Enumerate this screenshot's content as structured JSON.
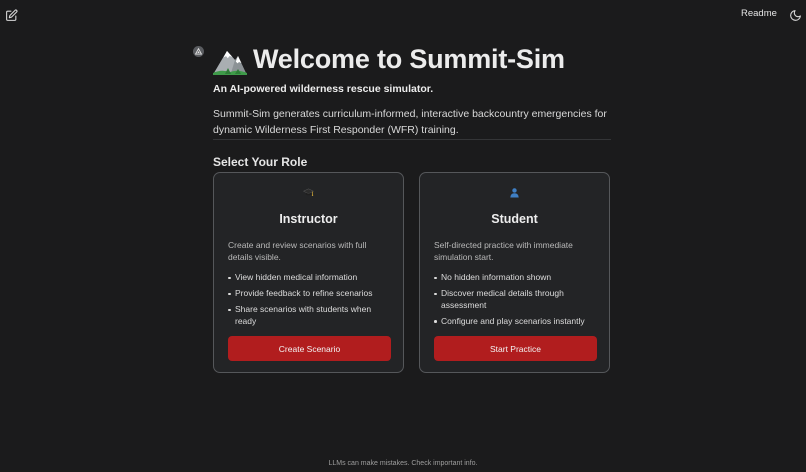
{
  "header": {
    "new_chat_icon": "pencil-square-icon",
    "readme_label": "Readme",
    "theme_icon": "moon-icon"
  },
  "welcome": {
    "avatar_icon": "assistant-logo-icon",
    "title_emoji_icon": "snow-mountain-icon",
    "title": "Welcome to Summit-Sim",
    "subtitle": "An AI-powered wilderness rescue simulator.",
    "description": "Summit-Sim generates curriculum-informed, interactive backcountry emergencies for dynamic Wilderness First Responder (WFR) training."
  },
  "roles": {
    "section_title": "Select Your Role",
    "cards": [
      {
        "icon": "graduation-cap-icon",
        "title": "Instructor",
        "description": "Create and review scenarios with full details visible.",
        "features": [
          "View hidden medical information",
          "Provide feedback to refine scenarios",
          "Share scenarios with students when ready"
        ],
        "button_label": "Create Scenario"
      },
      {
        "icon": "person-silhouette-icon",
        "title": "Student",
        "description": "Self-directed practice with immediate simulation start.",
        "features": [
          "No hidden information shown",
          "Discover medical details through assessment",
          "Configure and play scenarios instantly"
        ],
        "button_label": "Start Practice"
      }
    ]
  },
  "colors": {
    "background": "#1b1b1c",
    "card_background": "#232426",
    "card_border": "#55575a",
    "accent_button": "#b11d1e"
  },
  "footer": {
    "disclaimer": "LLMs can make mistakes. Check important info."
  }
}
